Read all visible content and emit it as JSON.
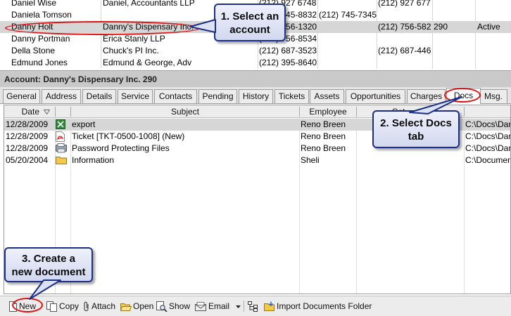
{
  "accounts": [
    {
      "name": "Daniel Wise",
      "company": "Daniel, Accountants LLP",
      "phone1": "(212) 927 6748",
      "phone2": "",
      "phone3": "(212) 927 677",
      "ext": "",
      "status": ""
    },
    {
      "name": "Daniela Tomson",
      "company": "",
      "phone1": "(212) 745-8832",
      "phone2": "(212) 745-7345",
      "phone3": "",
      "ext": "",
      "status": ""
    },
    {
      "name": "Danny Holt",
      "company": "Danny's Dispensary Inc.",
      "phone1": "(212) 756-1320",
      "phone2": "",
      "phone3": "(212) 756-582",
      "ext": "290",
      "status": "Active",
      "selected": true
    },
    {
      "name": "Danny Portman",
      "company": "Erica Stanly LLP",
      "phone1": "(212) 756-8534",
      "phone2": "",
      "phone3": "",
      "ext": "",
      "status": ""
    },
    {
      "name": "Della Stone",
      "company": "Chuck's PI Inc.",
      "phone1": "(212) 687-3523",
      "phone2": "",
      "phone3": "(212) 687-446",
      "ext": "",
      "status": ""
    },
    {
      "name": "Edmund Jones",
      "company": "Edmund & George, Adv",
      "phone1": "(212) 395-8640",
      "phone2": "",
      "phone3": "",
      "ext": "",
      "status": ""
    }
  ],
  "account_header": "Account:  Danny's Dispensary Inc. 290",
  "tabs": [
    "General",
    "Address",
    "Details",
    "Service",
    "Contacts",
    "Pending",
    "History",
    "Tickets",
    "Assets",
    "Opportunities",
    "Charges",
    "Docs",
    "Msg."
  ],
  "active_tab": "Docs",
  "docs_columns": {
    "date": "Date",
    "subject": "Subject",
    "employee": "Employee",
    "category": "Cat"
  },
  "documents": [
    {
      "date": "12/28/2009",
      "icon": "excel-icon",
      "subject": "export",
      "employee": "Reno Breen",
      "path": "C:\\Docs\\Dan",
      "selected": true
    },
    {
      "date": "12/28/2009",
      "icon": "pdf-icon",
      "subject": "Ticket [TKT-0500-1008] (New)",
      "employee": "Reno Breen",
      "path": "C:\\Docs\\Dan"
    },
    {
      "date": "12/28/2009",
      "icon": "document-icon",
      "subject": "Password Protecting Files",
      "employee": "Reno Breen",
      "path": "C:\\Docs\\Dan"
    },
    {
      "date": "05/20/2004",
      "icon": "folder-icon",
      "subject": "Information",
      "employee": "Sheli",
      "path": "C:\\Documen"
    }
  ],
  "toolbar": {
    "new": "New",
    "copy": "Copy",
    "attach": "Attach",
    "open": "Open",
    "show": "Show",
    "email": "Email",
    "import": "Import Documents Folder"
  },
  "callouts": {
    "step1": [
      "1. Select an",
      "account"
    ],
    "step2": [
      "2. Select Docs",
      "tab"
    ],
    "step3": [
      "3. Create a",
      "new document"
    ]
  },
  "colors": {
    "callout_border": "#1b2f8a",
    "highlight_ring": "#e01010",
    "selected_row": "#d6d6d6"
  }
}
